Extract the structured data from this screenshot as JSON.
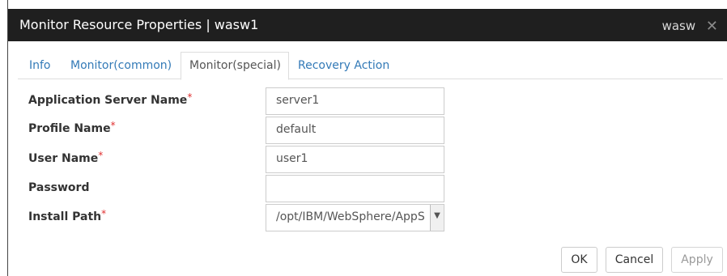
{
  "window": {
    "title": "Monitor Resource Properties | wasw1",
    "right_label": "wasw",
    "close_icon": "close-icon"
  },
  "tabs": [
    {
      "label": "Info",
      "active": false
    },
    {
      "label": "Monitor(common)",
      "active": false
    },
    {
      "label": "Monitor(special)",
      "active": true
    },
    {
      "label": "Recovery Action",
      "active": false
    }
  ],
  "form": {
    "required_mark": "*",
    "application_server_name": {
      "label": "Application Server Name",
      "value": "server1"
    },
    "profile_name": {
      "label": "Profile Name",
      "value": "default"
    },
    "user_name": {
      "label": "User Name",
      "value": "user1"
    },
    "password": {
      "label": "Password",
      "value": ""
    },
    "install_path": {
      "label": "Install Path",
      "value": "/opt/IBM/WebSphere/AppS"
    }
  },
  "buttons": {
    "ok": "OK",
    "cancel": "Cancel",
    "apply": "Apply"
  },
  "colors": {
    "titlebar_bg": "#1f1f1f",
    "tab_link": "#337ab7",
    "required": "#e03030"
  }
}
